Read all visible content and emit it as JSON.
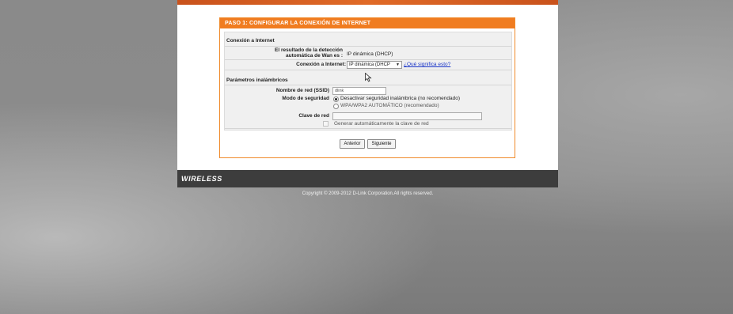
{
  "panel": {
    "title": "PASO 1: CONFIGURAR LA CONEXIÓN DE INTERNET"
  },
  "internet": {
    "section_title": "Conexión a Internet",
    "detect_label_line1": "El resultado de la detección",
    "detect_label_line2": "automática de Wan es :",
    "detect_value": "IP dinámica (DHCP)",
    "connection_label": "Conexión a Internet:",
    "connection_selected": "IP dinámica (DHCP",
    "help_link": "¿Qué significa esto?"
  },
  "wireless": {
    "section_title": "Parámetros inalámbricos",
    "ssid_label": "Nombre de red (SSID)",
    "ssid_value": "dlink",
    "security_label": "Modo de seguridad",
    "security_option_off": "Desactivar seguridad inalámbrica (no recomendado)",
    "security_option_wpa": "WPA/WPA2 AUTOMÁTICO (recomendado)",
    "key_label": "Clave de red",
    "key_value": "",
    "auto_key_label": "Generar automáticamente la clave de red"
  },
  "buttons": {
    "back": "Anterior",
    "next": "Siguiente"
  },
  "footer": {
    "brand": "WIRELESS",
    "copyright": "Copyright © 2009-2012 D-Link Corporation.All rights reserved."
  },
  "icons": {
    "select_arrow": "chevron-down-icon",
    "cursor": "mouse-pointer-icon"
  },
  "colors": {
    "accent_orange": "#f07c20",
    "footer_dark": "#3d3d3d",
    "link_blue": "#1a35c7"
  }
}
